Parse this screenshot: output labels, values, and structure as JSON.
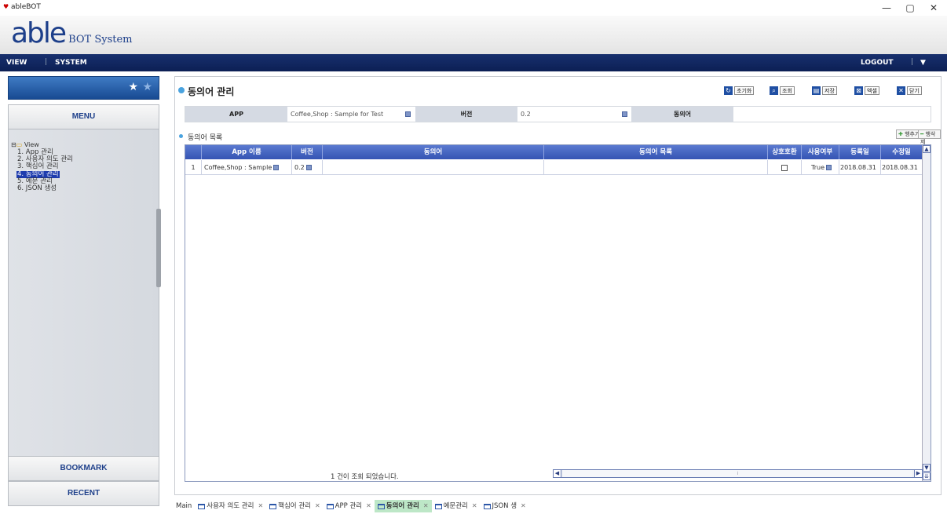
{
  "window": {
    "title": "ableBOT",
    "icon": "app-heart-icon",
    "controls": [
      "—",
      "▢",
      "✕"
    ]
  },
  "header": {
    "logo_main": "able",
    "logo_sub": "BOT System"
  },
  "navbar": {
    "items": [
      "VIEW",
      "SYSTEM"
    ],
    "logout": "LOGOUT",
    "dropdown_icon": "▼"
  },
  "sidebar": {
    "menu_label": "MENU",
    "bookmark_label": "BOOKMARK",
    "recent_label": "RECENT",
    "tree_root": "View",
    "items": [
      {
        "label": "1. App 관리"
      },
      {
        "label": "2. 사용자 의도 관리"
      },
      {
        "label": "3. 핵심어 관리"
      },
      {
        "label": "4. 동의어 관리",
        "active": true
      },
      {
        "label": "5. 예문 관리"
      },
      {
        "label": "6. JSON 생성"
      }
    ]
  },
  "main": {
    "title": "동의어 관리",
    "toolbar": {
      "reset": "초기화",
      "search": "조회",
      "save": "저장",
      "excel": "엑셀",
      "close": "닫기"
    },
    "filters": {
      "app_label": "APP",
      "app_value": "Coffee,Shop : Sample for Test",
      "version_label": "버전",
      "version_value": "0.2",
      "synonym_label": "동의어",
      "synonym_value": ""
    },
    "list_title": "동의어 목록",
    "row_add": "행추가",
    "row_delete": "행삭제",
    "columns": [
      "App 이름",
      "버전",
      "동의어",
      "동의어 목록",
      "상호호환",
      "사용여부",
      "등록일",
      "수정일"
    ],
    "rows": [
      {
        "no": "1",
        "app_name": "Coffee,Shop : Sample",
        "version": "0.2",
        "synonym": "",
        "synonym_list": "",
        "mutual": false,
        "use": "True",
        "created": "2018.08.31",
        "modified": "2018.08.31"
      }
    ],
    "status": "1 건이 조회 되었습니다."
  },
  "tabs": [
    {
      "label": "Main",
      "icon": false,
      "close": false,
      "active": false
    },
    {
      "label": "사용자 의도 관리",
      "icon": true,
      "close": true,
      "active": false
    },
    {
      "label": "핵심어 관리",
      "icon": true,
      "close": true,
      "active": false
    },
    {
      "label": "APP 관리",
      "icon": true,
      "close": true,
      "active": false
    },
    {
      "label": "동의어 관리",
      "icon": true,
      "close": true,
      "active": true
    },
    {
      "label": "예문관리",
      "icon": true,
      "close": true,
      "active": false
    },
    {
      "label": "JSON 생",
      "icon": true,
      "close": true,
      "active": false
    }
  ],
  "colors": {
    "brand": "#1d3f8a",
    "nav": "#0c1f54",
    "grid_header": "#3554b3",
    "active_tab": "#bde7c7",
    "selection": "#1e3cae"
  }
}
